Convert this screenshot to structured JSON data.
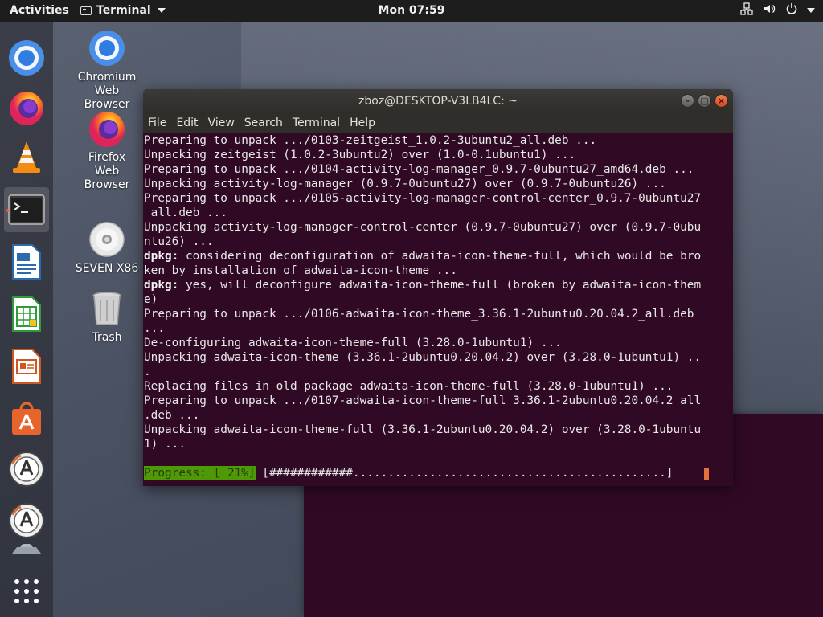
{
  "topbar": {
    "activities": "Activities",
    "app_name": "Terminal",
    "clock": "Mon 07:59"
  },
  "desktop": {
    "icons": [
      {
        "label": "Chromium\nWeb\nBrowser"
      },
      {
        "label": "Firefox\nWeb\nBrowser"
      },
      {
        "label": "SEVEN X86"
      },
      {
        "label": "Trash"
      }
    ]
  },
  "terminal": {
    "title": "zboz@DESKTOP-V3LB4LC: ~",
    "menu": [
      "File",
      "Edit",
      "View",
      "Search",
      "Terminal",
      "Help"
    ],
    "lines": [
      "Preparing to unpack .../0103-zeitgeist_1.0.2-3ubuntu2_all.deb ...",
      "Unpacking zeitgeist (1.0.2-3ubuntu2) over (1.0-0.1ubuntu1) ...",
      "Preparing to unpack .../0104-activity-log-manager_0.9.7-0ubuntu27_amd64.deb ...",
      "Unpacking activity-log-manager (0.9.7-0ubuntu27) over (0.9.7-0ubuntu26) ...",
      "Preparing to unpack .../0105-activity-log-manager-control-center_0.9.7-0ubuntu27",
      "_all.deb ...",
      "Unpacking activity-log-manager-control-center (0.9.7-0ubuntu27) over (0.9.7-0ubu",
      "ntu26) ...",
      "dpkg: considering deconfiguration of adwaita-icon-theme-full, which would be bro",
      "ken by installation of adwaita-icon-theme ...",
      "dpkg: yes, will deconfigure adwaita-icon-theme-full (broken by adwaita-icon-them",
      "e)",
      "Preparing to unpack .../0106-adwaita-icon-theme_3.36.1-2ubuntu0.20.04.2_all.deb",
      "...",
      "De-configuring adwaita-icon-theme-full (3.28.0-1ubuntu1) ...",
      "Unpacking adwaita-icon-theme (3.36.1-2ubuntu0.20.04.2) over (3.28.0-1ubuntu1) ..",
      ".",
      "Replacing files in old package adwaita-icon-theme-full (3.28.0-1ubuntu1) ...",
      "Preparing to unpack .../0107-adwaita-icon-theme-full_3.36.1-2ubuntu0.20.04.2_all",
      ".deb ...",
      "Unpacking adwaita-icon-theme-full (3.36.1-2ubuntu0.20.04.2) over (3.28.0-1ubuntu",
      "1) ..."
    ],
    "progress_label": "Progress: [ 21%]",
    "progress_bar": " [############.............................................] "
  }
}
